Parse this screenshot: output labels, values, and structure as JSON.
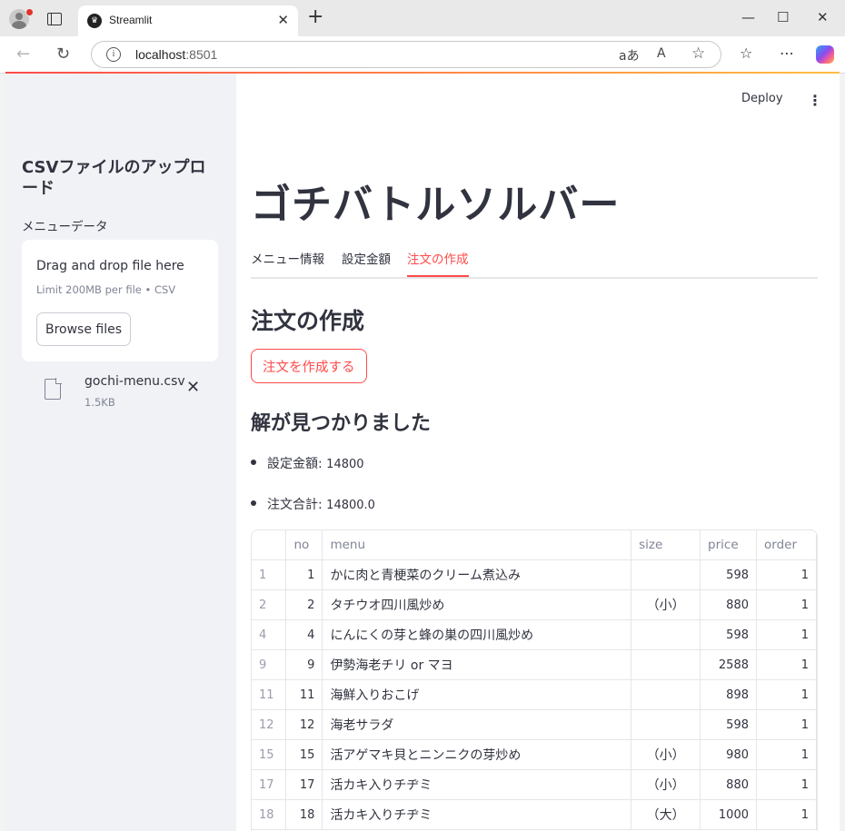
{
  "browser": {
    "tab_title": "Streamlit",
    "url_host": "localhost",
    "url_port": ":8501"
  },
  "sidebar": {
    "title": "CSVファイルのアップロード",
    "uploader_label": "メニューデータ",
    "dropzone_text": "Drag and drop file here",
    "dropzone_limit": "Limit 200MB per file • CSV",
    "browse_label": "Browse files",
    "file_name": "gochi-menu.csv",
    "file_size": "1.5KB"
  },
  "header": {
    "deploy_label": "Deploy"
  },
  "main": {
    "title": "ゴチバトルソルバー",
    "tabs": [
      {
        "label": "メニュー情報",
        "active": false
      },
      {
        "label": "設定金額",
        "active": false
      },
      {
        "label": "注文の作成",
        "active": true
      }
    ],
    "section_title": "注文の作成",
    "create_button_label": "注文を作成する",
    "result_title": "解が見つかりました",
    "bullets": [
      {
        "label": "設定金額: ",
        "value": "14800"
      },
      {
        "label": "注文合計: ",
        "value": "14800.0"
      }
    ],
    "table": {
      "columns": [
        "",
        "no",
        "menu",
        "size",
        "price",
        "order"
      ],
      "rows": [
        [
          "1",
          "1",
          "かに肉と青梗菜のクリーム煮込み",
          "",
          "598",
          "1"
        ],
        [
          "2",
          "2",
          "タチウオ四川風炒め",
          "（小）",
          "880",
          "1"
        ],
        [
          "4",
          "4",
          "にんにくの芽と蜂の巣の四川風炒め",
          "",
          "598",
          "1"
        ],
        [
          "9",
          "9",
          "伊勢海老チリ or マヨ",
          "",
          "2588",
          "1"
        ],
        [
          "11",
          "11",
          "海鮮入りおこげ",
          "",
          "898",
          "1"
        ],
        [
          "12",
          "12",
          "海老サラダ",
          "",
          "598",
          "1"
        ],
        [
          "15",
          "15",
          "活アゲマキ貝とニンニクの芽炒め",
          "（小）",
          "980",
          "1"
        ],
        [
          "17",
          "17",
          "活カキ入りチヂミ",
          "（小）",
          "880",
          "1"
        ],
        [
          "18",
          "18",
          "活カキ入りチヂミ",
          "（大）",
          "1000",
          "1"
        ]
      ]
    }
  },
  "colors": {
    "accent": "#ff4b4b",
    "sidebar_bg": "#f0f2f6",
    "text": "#31333f"
  }
}
